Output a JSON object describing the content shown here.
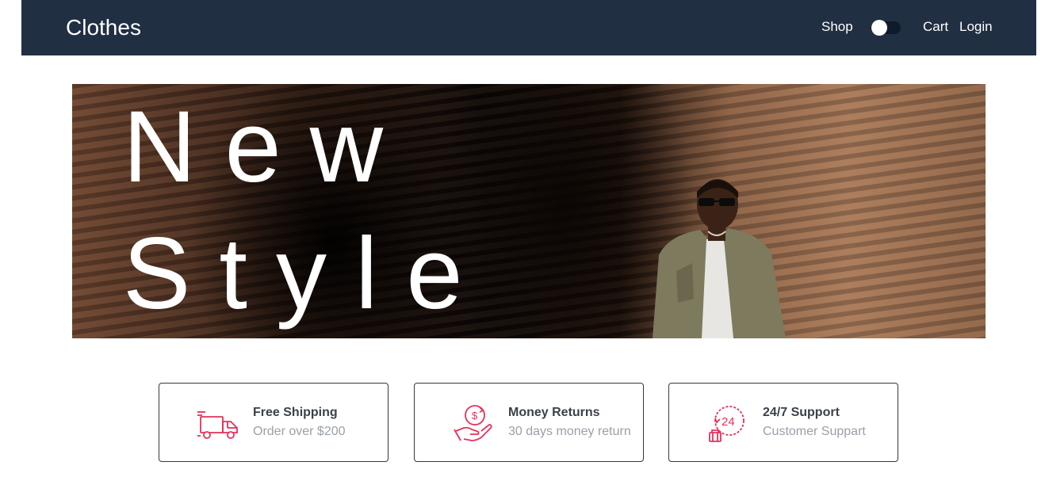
{
  "navbar": {
    "brand": "Clothes",
    "links": {
      "shop": "Shop",
      "cart": "Cart",
      "login": "Login"
    },
    "theme_toggle": {
      "state": "off"
    },
    "background": "#212f43"
  },
  "hero": {
    "line1": "New",
    "line2": "Style",
    "image": "man-in-olive-jacket-against-rock-wall"
  },
  "features": [
    {
      "icon": "delivery-truck-icon",
      "title": "Free Shipping",
      "subtitle": "Order over $200"
    },
    {
      "icon": "money-return-icon",
      "title": "Money Returns",
      "subtitle": "30 days money return"
    },
    {
      "icon": "support-24-7-icon",
      "title": "24/7 Support",
      "subtitle": "Customer Suppart"
    }
  ],
  "colors": {
    "accent": "#e8305a",
    "title_text": "#3a414b",
    "muted_text": "#9aa0a8"
  }
}
